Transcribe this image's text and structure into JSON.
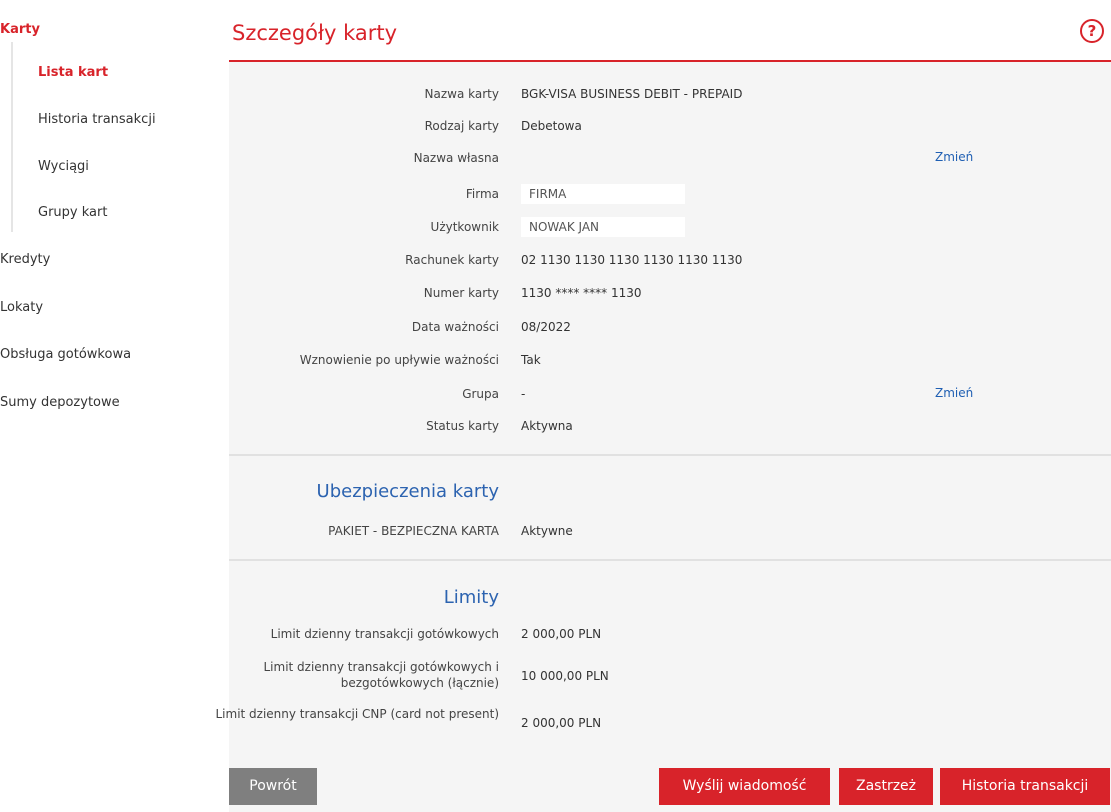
{
  "sidebar": {
    "karty": "Karty",
    "lista_kart": "Lista kart",
    "historia_transakcji": "Historia transakcji",
    "wyciagi": "Wyciągi",
    "grupy_kart": "Grupy kart",
    "kredyty": "Kredyty",
    "lokaty": "Lokaty",
    "obsluga_gotowkowa": "Obsługa gotówkowa",
    "sumy_depozytowe": "Sumy depozytowe"
  },
  "header": {
    "title": "Szczegóły karty",
    "help": "?"
  },
  "details": [
    {
      "label": "Nazwa karty",
      "value": "BGK-VISA BUSINESS DEBIT - PREPAID"
    },
    {
      "label": "Rodzaj karty",
      "value": "Debetowa"
    },
    {
      "label": "Nazwa własna",
      "value": "",
      "link": "Zmień"
    },
    {
      "label": "Firma",
      "value": "FIRMA"
    },
    {
      "label": "Użytkownik",
      "value": "NOWAK JAN"
    },
    {
      "label": "Rachunek karty",
      "value": "02 1130 1130 1130 1130 1130 1130"
    },
    {
      "label": "Numer karty",
      "value": "1130 **** **** 1130"
    },
    {
      "label": "Data ważności",
      "value": "08/2022"
    },
    {
      "label": "Wznowienie po upływie ważności",
      "value": "Tak"
    },
    {
      "label": "Grupa",
      "value": "-",
      "link": "Zmień"
    },
    {
      "label": "Status karty",
      "value": "Aktywna"
    }
  ],
  "insurance": {
    "title": "Ubezpieczenia karty",
    "items": [
      {
        "label": "PAKIET - BEZPIECZNA KARTA",
        "value": "Aktywne"
      }
    ]
  },
  "limits": {
    "title": "Limity",
    "items": [
      {
        "label": "Limit dzienny transakcji gotówkowych",
        "value": "2 000,00 PLN"
      },
      {
        "label": "Limit dzienny transakcji gotówkowych i bezgotówkowych (łącznie)",
        "value": "10 000,00 PLN"
      },
      {
        "label": "Limit dzienny transakcji CNP (card not present)",
        "value": "2 000,00 PLN"
      }
    ]
  },
  "buttons": {
    "back": "Powrót",
    "send_message": "Wyślij wiadomość",
    "block": "Zastrzeż",
    "history": "Historia transakcji"
  },
  "colors": {
    "accent": "#d8232a",
    "link": "#1f5fb3",
    "section": "#2c63b0"
  }
}
